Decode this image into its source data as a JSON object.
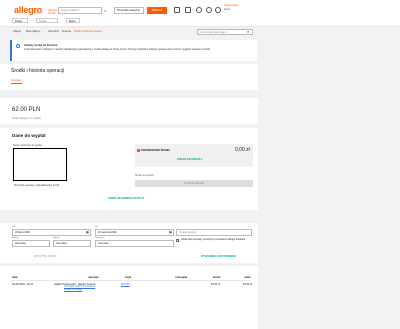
{
  "header": {
    "logo": "allegro",
    "logo_sub": "Allegro Smart",
    "search_placeholder": "czego szukasz?",
    "category": "Wszystkie kategorie",
    "search_button": "SZUKAJ",
    "user_line1": "Twoje Allegro",
    "user_line2": "konto"
  },
  "subnav": {
    "items": [
      "Dziaty",
      "Strefa",
      "Marki"
    ]
  },
  "breadcrumb": {
    "items": [
      "Allegro",
      "Moje Allegro",
      "Sprzedaż",
      "Finanse",
      "Środki i historia operacji"
    ],
    "search_placeholder": "przeszukaj Moje Allegro"
  },
  "info": {
    "title": "Zmiany konta na Finanse",
    "text": "Jeśli korzystasz z Allegro w ramach działalności gospodarczej, środki trafiają na Twoje konto. Poniżej znajdziesz historię operacji oraz możesz wypłacić dostępne środki."
  },
  "page": {
    "title": "Środki i historia operacji",
    "tab": "Operacje"
  },
  "balance": {
    "amount": "62.00 PLN",
    "note": "Środki dostępne do wypłaty"
  },
  "payout": {
    "title": "Dane do wypłat",
    "account_label": "Numer rachunku do wypłat",
    "account_note": "Wszystkie operacje, zaktualizowane 22.08 ...",
    "saved_label": "ZGROMADZONE ŚRODKI",
    "saved_amount": "0,00 zł",
    "saved_link": "POKAŻ SZCZEGÓŁY",
    "payout_label": "Środki do wypłaty",
    "payout_button": "WYPŁAĆ ŚRODKI",
    "howto": "ZMIEŃ USTAWIENIA WYPŁAT"
  },
  "filters": {
    "date_from_label": "Od",
    "date_from": "20 lipca 2020",
    "date_to_label": "Do",
    "date_to": "20 sierpnia 2020",
    "search_placeholder": "Szukaj operacji",
    "type_label": "Rodzaj",
    "type_value": "wszystkie",
    "market_label": "Rynek",
    "market_value": "wszystkie",
    "category_label": "Kategoria",
    "category_value": "wszystkie",
    "checkbox_label": "pokaż tylko operacje, do których przeniesiono Allegro Standard",
    "clear_link": "WYCZYŚĆ FILTRY",
    "export_link": "WYGENERUJ ZESTAWIENIE"
  },
  "table": {
    "headers": [
      "data",
      "operacja",
      "login",
      "szczegóły",
      "kwota",
      "saldo"
    ],
    "row": {
      "date": "06.08.2020, 14:24",
      "operation": "wpłata Przelewy24 - Allegro Finanse",
      "operation_sub": "Szczegóły wpłat z 2 zamówień",
      "operation_sub2": "Zobacz szczegóły",
      "login": "Mr1234",
      "details": "-",
      "amount": "62,00 zł",
      "balance": "62,00 zł"
    }
  }
}
